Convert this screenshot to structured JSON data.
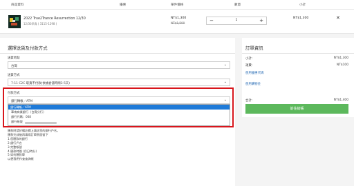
{
  "cart": {
    "headers": {
      "product": "商品資料",
      "discount": "優惠",
      "unit_price": "單件價格",
      "quantity": "數量",
      "subtotal": "小計"
    },
    "item": {
      "name": "2022 True2Trance Resurrection 12/30",
      "variant": "12/30早鳥 ( 3115-1298 )",
      "price": "NT$1,300",
      "original_price": "NT$1,500",
      "quantity": "1",
      "subtotal": "NT$1,300"
    },
    "icons": {
      "minus": "minus-icon",
      "plus": "plus-icon",
      "remove": "close-icon"
    }
  },
  "delivery": {
    "title": "選擇送貨及付款方式",
    "region_label": "送貨地點",
    "region_value": "台灣",
    "method_label": "送貨方式",
    "method_value": "7-11 C2C 取貨不付款(依據倉儲時間3-5天)",
    "payment_label": "付款方式",
    "payment_value": "銀行轉帳／ATM",
    "dropdown_selected": "銀行轉帳／ATM",
    "bank_name": "華南商業銀行（台實分行）",
    "bank_code": "銀行代碼：008",
    "bank_account": "銀行帳號",
    "instructions": [
      "匯款時請於備註欄上填註您的銀行戶名。",
      "匯款完成後再填寫訂單頁面留下",
      "1.您匯款的銀行",
      "2.銀行戶名",
      "3.完整帳號",
      "4.匯款時間 (月日時分)",
      "5.如何匯款單",
      "以便我們作查查詢帳"
    ]
  },
  "summary": {
    "title": "訂單資訊",
    "subtotal_label": "小計:",
    "subtotal_value": "NT$1,300",
    "shipping_label": "運費:",
    "shipping_value": "NT$100",
    "coupon_link": "使用優惠代碼",
    "points_link": "使用購物金",
    "total_label": "合計:",
    "total_value": "NT$1,400",
    "checkout_label": "前往結帳"
  },
  "colors": {
    "highlight": "#d8161c",
    "checkout_green": "#5cb85c",
    "dropdown_blue": "#1e7ad8",
    "link_blue": "#2a6db5"
  }
}
